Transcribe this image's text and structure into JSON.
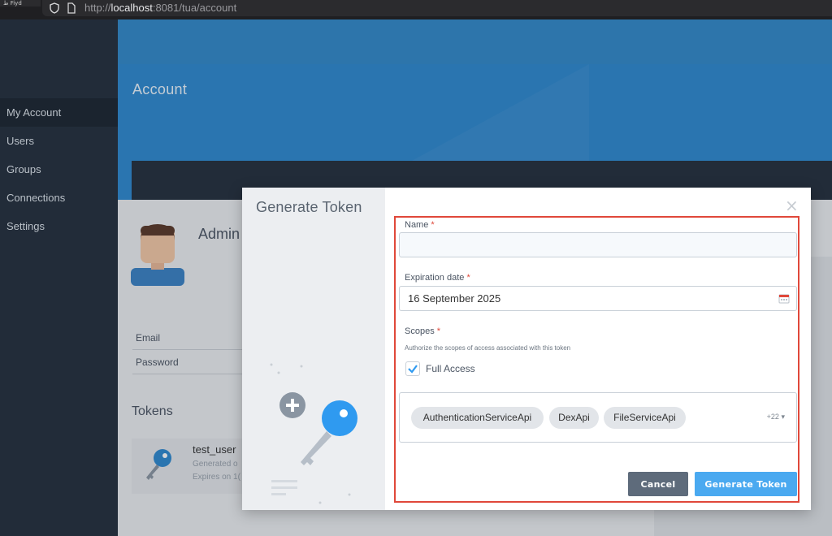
{
  "browser": {
    "tab_stub": "ط‌ Fiyd",
    "url_prefix": "http://",
    "url_host": "localhost",
    "url_rest": ":8081/tua/account"
  },
  "sidebar": {
    "items": [
      {
        "label": "My Account",
        "active": true
      },
      {
        "label": "Users"
      },
      {
        "label": "Groups"
      },
      {
        "label": "Connections"
      },
      {
        "label": "Settings"
      }
    ]
  },
  "page": {
    "title": "Account",
    "admin_name": "Admin",
    "fields": [
      {
        "label": "Email"
      },
      {
        "label": "Password"
      }
    ],
    "tokens_title": "Tokens",
    "token": {
      "user": "test_user",
      "generated": "Generated o",
      "expires": "Expires on 1("
    }
  },
  "modal": {
    "title": "Generate Token",
    "close_icon": "close-icon",
    "name_label": "Name",
    "name_value": "",
    "expiration_label": "Expiration date",
    "expiration_value": "16 September 2025",
    "scopes_label": "Scopes",
    "scopes_hint": "Authorize the scopes of access associated with this token",
    "full_access_label": "Full Access",
    "full_access_checked": true,
    "scope_chips": [
      "AuthenticationServiceApi",
      "DexApi",
      "FileServiceApi"
    ],
    "more_count": "+22",
    "cancel_label": "Cancel",
    "generate_label": "Generate Token",
    "required_mark": "*"
  },
  "colors": {
    "accent": "#4aa9f0",
    "highlight": "#e0483a",
    "sidebar": "#25303d",
    "hero": "#2f89cf"
  }
}
